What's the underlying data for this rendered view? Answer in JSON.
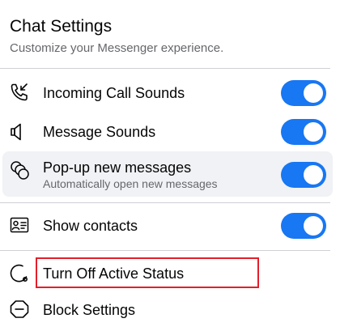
{
  "header": {
    "title": "Chat Settings",
    "subtitle": "Customize your Messenger experience."
  },
  "settings": [
    {
      "label": "Incoming Call Sounds",
      "icon": "incoming-call-icon",
      "enabled": true
    },
    {
      "label": "Message Sounds",
      "icon": "speaker-icon",
      "enabled": true
    },
    {
      "label": "Pop-up new messages",
      "sublabel": "Automatically open new messages",
      "icon": "popup-messages-icon",
      "enabled": true
    },
    {
      "label": "Show contacts",
      "icon": "contacts-card-icon",
      "enabled": true
    }
  ],
  "actions": [
    {
      "label": "Turn Off Active Status",
      "icon": "active-status-icon"
    },
    {
      "label": "Block Settings",
      "icon": "block-icon"
    }
  ],
  "colors": {
    "toggle_on": "#1877f2",
    "highlight_bg": "#f0f2f5",
    "outline_red": "#e41e2b",
    "secondary_text": "#65676b"
  }
}
